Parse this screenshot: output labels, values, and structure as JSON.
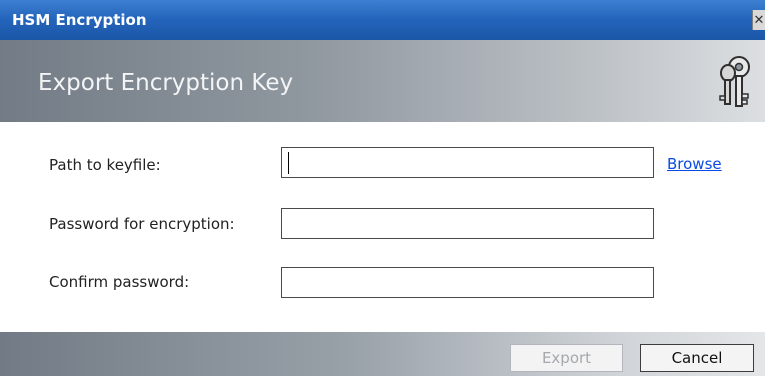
{
  "window": {
    "title": "HSM Encryption",
    "close_icon": "close-icon"
  },
  "header": {
    "title": "Export Encryption Key",
    "icon": "keys-icon"
  },
  "form": {
    "path_label": "Path to keyfile:",
    "path_value": "",
    "browse_label": "Browse",
    "password_label": "Password for encryption:",
    "password_value": "",
    "confirm_label": "Confirm password:",
    "confirm_value": ""
  },
  "footer": {
    "export_label": "Export",
    "export_enabled": false,
    "cancel_label": "Cancel"
  },
  "colors": {
    "titlebar": "#2364bb",
    "header_gray": "#8f979f",
    "link": "#0a4be6"
  }
}
